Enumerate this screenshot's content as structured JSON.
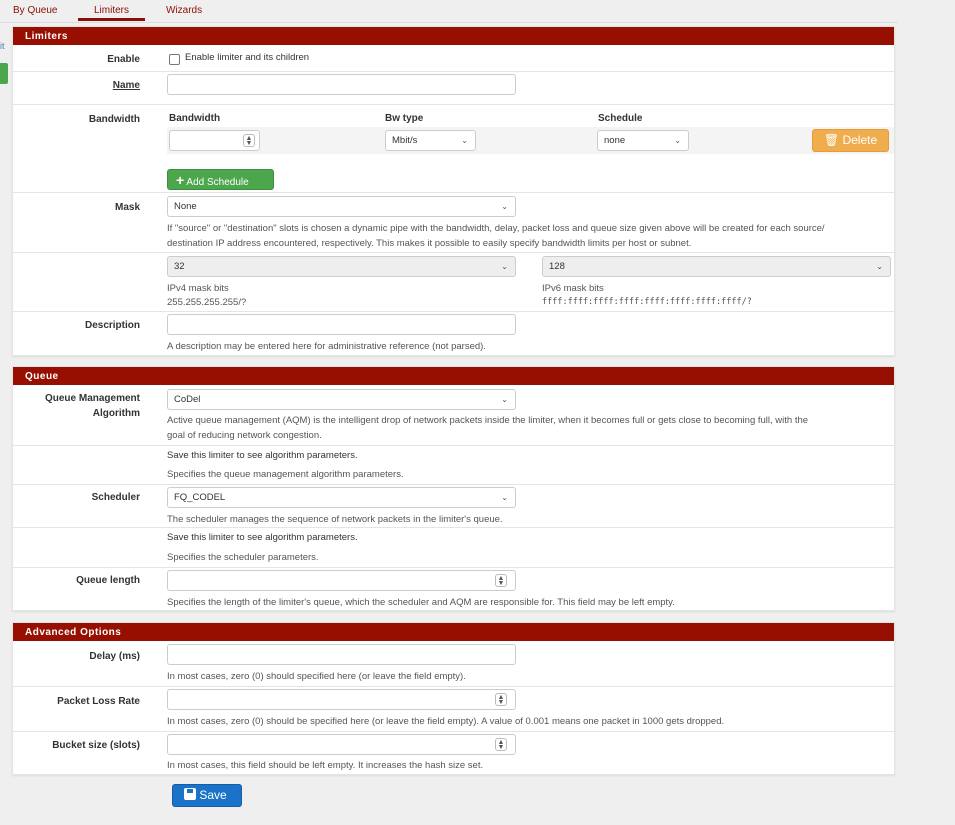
{
  "tabs": [
    {
      "label": "By Queue"
    },
    {
      "label": "Limiters"
    },
    {
      "label": "Wizards"
    }
  ],
  "side_fragment": "it",
  "limiters": {
    "title": "Limiters",
    "enable_label": "Enable",
    "enable_checkbox_text": "Enable limiter and its children",
    "name_label": "Name",
    "name_value": "",
    "bandwidth_label": "Bandwidth",
    "col_bandwidth": "Bandwidth",
    "col_bwtype": "Bw type",
    "col_schedule": "Schedule",
    "bandwidth_value": "",
    "bwtype_value": "Mbit/s",
    "schedule_value": "none",
    "delete_label": "Delete",
    "add_schedule_label": "Add Schedule",
    "mask_label": "Mask",
    "mask_value": "None",
    "mask_help_1": "If \"source\" or \"destination\" slots is chosen a dynamic pipe with the bandwidth, delay, packet loss and queue size given above will be created for each source/",
    "mask_help_2": "destination IP address encountered, respectively. This makes it possible to easily specify bandwidth limits per host or subnet.",
    "ipv4_mask_value": "32",
    "ipv4_mask_label": "IPv4 mask bits",
    "ipv4_mask_hint": "255.255.255.255/?",
    "ipv6_mask_value": "128",
    "ipv6_mask_label": "IPv6 mask bits",
    "ipv6_mask_hint": "ffff:ffff:ffff:ffff:ffff:ffff:ffff:ffff/?",
    "description_label": "Description",
    "description_value": "",
    "description_help": "A description may be entered here for administrative reference (not parsed)."
  },
  "queue": {
    "title": "Queue",
    "qma_label_1": "Queue Management",
    "qma_label_2": "Algorithm",
    "qma_value": "CoDel",
    "qma_help_1": "Active queue management (AQM) is the intelligent drop of network packets inside the limiter, when it becomes full or gets close to becoming full, with the",
    "qma_help_2": "goal of reducing network congestion.",
    "qma_params_note": "Save this limiter to see algorithm parameters.",
    "qma_params_help": "Specifies the queue management algorithm parameters.",
    "scheduler_label": "Scheduler",
    "scheduler_value": "FQ_CODEL",
    "scheduler_help": "The scheduler manages the sequence of network packets in the limiter's queue.",
    "scheduler_params_note": "Save this limiter to see algorithm parameters.",
    "scheduler_params_help": "Specifies the scheduler parameters.",
    "queue_length_label": "Queue length",
    "queue_length_value": "",
    "queue_length_help": "Specifies the length of the limiter's queue, which the scheduler and AQM are responsible for. This field may be left empty."
  },
  "advanced": {
    "title": "Advanced Options",
    "delay_label": "Delay (ms)",
    "delay_value": "",
    "delay_help": "In most cases, zero (0) should specified here (or leave the field empty).",
    "plr_label": "Packet Loss Rate",
    "plr_value": "",
    "plr_help": "In most cases, zero (0) should be specified here (or leave the field empty). A value of 0.001 means one packet in 1000 gets dropped.",
    "bucket_label": "Bucket size (slots)",
    "bucket_value": "",
    "bucket_help": "In most cases, this field should be left empty. It increases the hash size set."
  },
  "save_label": "Save",
  "icons": {
    "chevron": "chevron-down-icon",
    "spinner": "spinner-icon",
    "plus": "plus-icon",
    "trash": "trash-icon",
    "save": "floppy-disk-icon"
  },
  "colors": {
    "panel_header": "#960f00",
    "tab_active": "#8b0e04",
    "add_button": "#4ca64c",
    "delete_button": "#f0ad4e",
    "save_button": "#1a73c8"
  }
}
